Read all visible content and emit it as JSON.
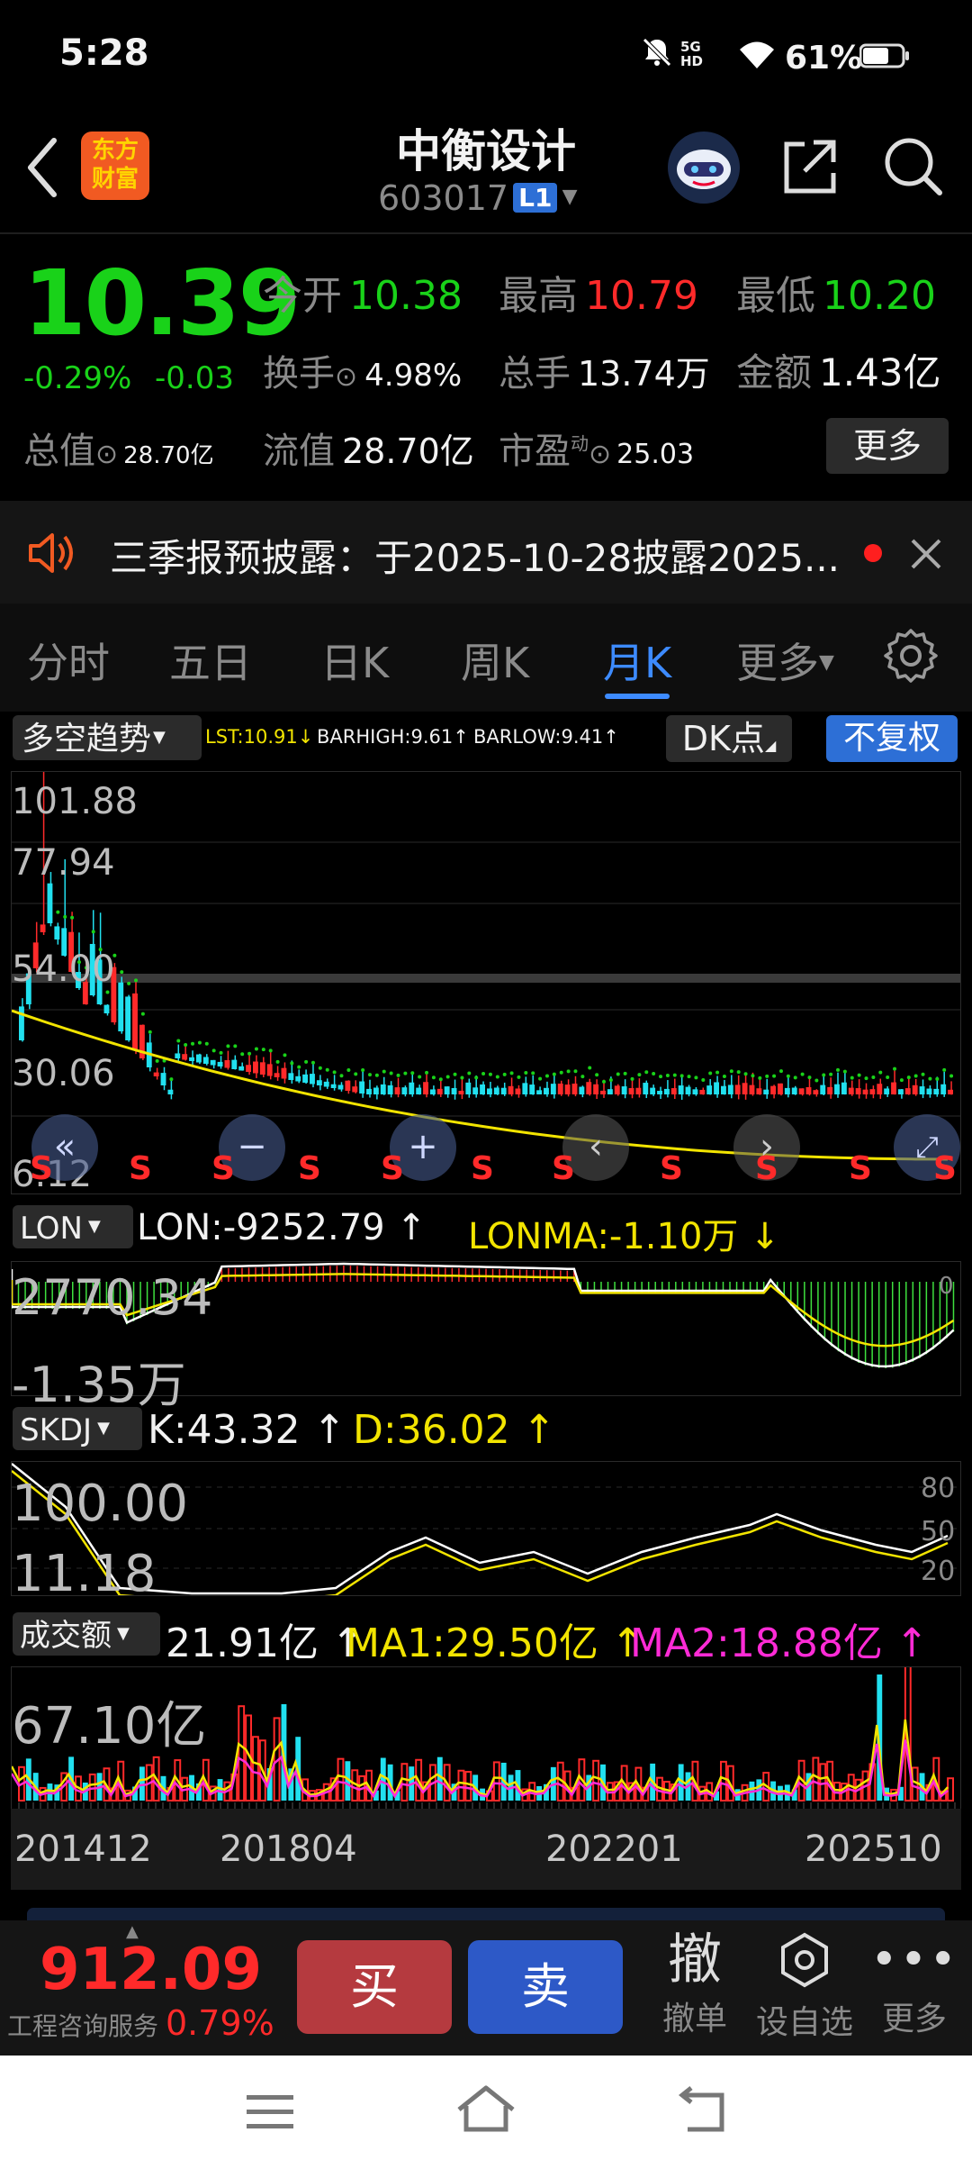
{
  "status_bar": {
    "time": "5:28",
    "net_label": "5G HD",
    "battery": "61%"
  },
  "header": {
    "logo_line1": "东方",
    "logo_line2": "财富",
    "title": "中衡设计",
    "code": "603017",
    "level_badge": "L1"
  },
  "quote": {
    "price": "10.39",
    "change_pct": "-0.29%",
    "change": "-0.03",
    "open_label": "今开",
    "open": "10.38",
    "high_label": "最高",
    "high": "10.79",
    "low_label": "最低",
    "low": "10.20",
    "turnover_label": "换手",
    "turnover": "4.98%",
    "volume_label": "总手",
    "volume": "13.74万",
    "amount_label": "金额",
    "amount": "1.43亿",
    "mktcap_label": "总值",
    "mktcap": "28.70亿",
    "float_label": "流值",
    "float": "28.70亿",
    "pe_label": "市盈",
    "pe_sup": "动",
    "pe": "25.03",
    "more_label": "更多"
  },
  "notice": {
    "text": "三季报预披露：于2025-10-28披露2025..."
  },
  "tabs": [
    {
      "label": "分时"
    },
    {
      "label": "五日"
    },
    {
      "label": "日K"
    },
    {
      "label": "周K"
    },
    {
      "label": "月K"
    },
    {
      "label": "更多"
    }
  ],
  "main_chart": {
    "indicator": "多空趋势",
    "lst": "LST:10.91",
    "barhigh": "BARHIGH:9.61",
    "barlow": "BARLOW:9.41",
    "dk_label": "DK点",
    "fq_label": "不复权",
    "y_labels": [
      "101.88",
      "77.94",
      "54.00",
      "30.06",
      "6.12"
    ],
    "signal": "S",
    "colors": {
      "up": "#ff2a2a",
      "down": "#21e0ef",
      "ma": "#f2e400",
      "dots": "#19d219"
    }
  },
  "lon_panel": {
    "name": "LON",
    "lon": "LON:-9252.79",
    "lonma": "LONMA:-1.10万",
    "y_top": "2770.34",
    "y_bottom": "-1.35万",
    "zero": "0"
  },
  "skdj_panel": {
    "name": "SKDJ",
    "k": "K:43.32",
    "d": "D:36.02",
    "y_top": "100.00",
    "y_bottom": "11.18",
    "levels": [
      "80",
      "50",
      "20"
    ]
  },
  "vol_panel": {
    "name": "成交额",
    "value": "21.91亿",
    "ma1": "MA1:29.50亿",
    "ma2": "MA2:18.88亿",
    "y_top": "67.10亿"
  },
  "x_axis": [
    "201412",
    "201804",
    "202201",
    "202510"
  ],
  "bottom_bar": {
    "index_value": "912.09",
    "index_name": "工程咨询服务",
    "index_pct": "0.79%",
    "buy_label": "买",
    "sell_label": "卖",
    "cancel_glyph": "撤",
    "cancel_label": "撤单",
    "watch_label": "设自选",
    "more_label": "更多"
  }
}
